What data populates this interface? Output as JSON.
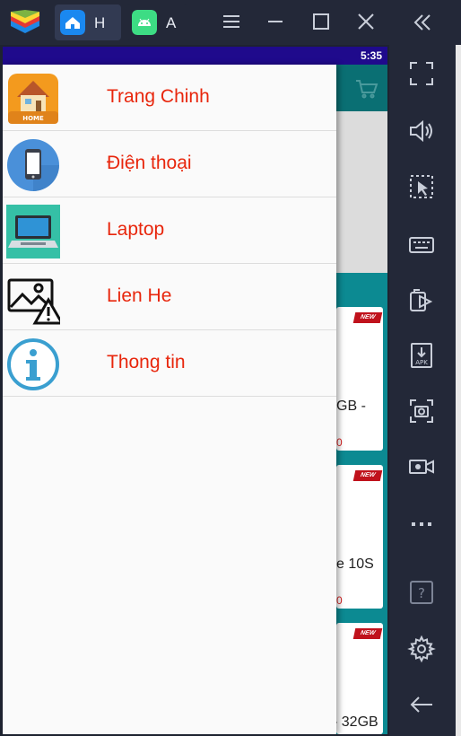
{
  "titlebar": {
    "tabs": [
      {
        "label": "H",
        "icon": "home-app-icon"
      },
      {
        "label": "A",
        "icon": "android-icon"
      }
    ],
    "icons": [
      "bluestacks-logo-icon",
      "menu-icon",
      "minimize-icon",
      "maximize-icon",
      "close-icon",
      "collapse-sidebar-icon"
    ]
  },
  "status_bar": {
    "time": "5:35"
  },
  "drawer": {
    "items": [
      {
        "label": "Trang Chinh",
        "icon": "home-house-icon"
      },
      {
        "label": "Điện thoại",
        "icon": "phone-icon"
      },
      {
        "label": "Laptop",
        "icon": "laptop-icon"
      },
      {
        "label": "Lien He",
        "icon": "broken-image-icon"
      },
      {
        "label": "Thong tin",
        "icon": "info-icon"
      }
    ]
  },
  "background_app": {
    "cards": [
      {
        "badge": "NEW",
        "text": "GB -",
        "price": "0"
      },
      {
        "badge": "NEW",
        "text": "e 10S",
        "price": "0"
      },
      {
        "badge": "NEW",
        "text": "- 32GB",
        "price": ""
      }
    ]
  },
  "sidebar_tools": [
    "fullscreen-icon",
    "volume-icon",
    "cursor-select-icon",
    "keyboard-icon",
    "install-app-icon",
    "apk-icon",
    "screenshot-icon",
    "record-video-icon",
    "more-icon",
    "help-icon",
    "settings-icon",
    "back-icon"
  ],
  "colors": {
    "accent_text": "#e8260c",
    "status_bar": "#1f0a8c",
    "app_toolbar": "#0a6f73",
    "chrome": "#232838"
  }
}
